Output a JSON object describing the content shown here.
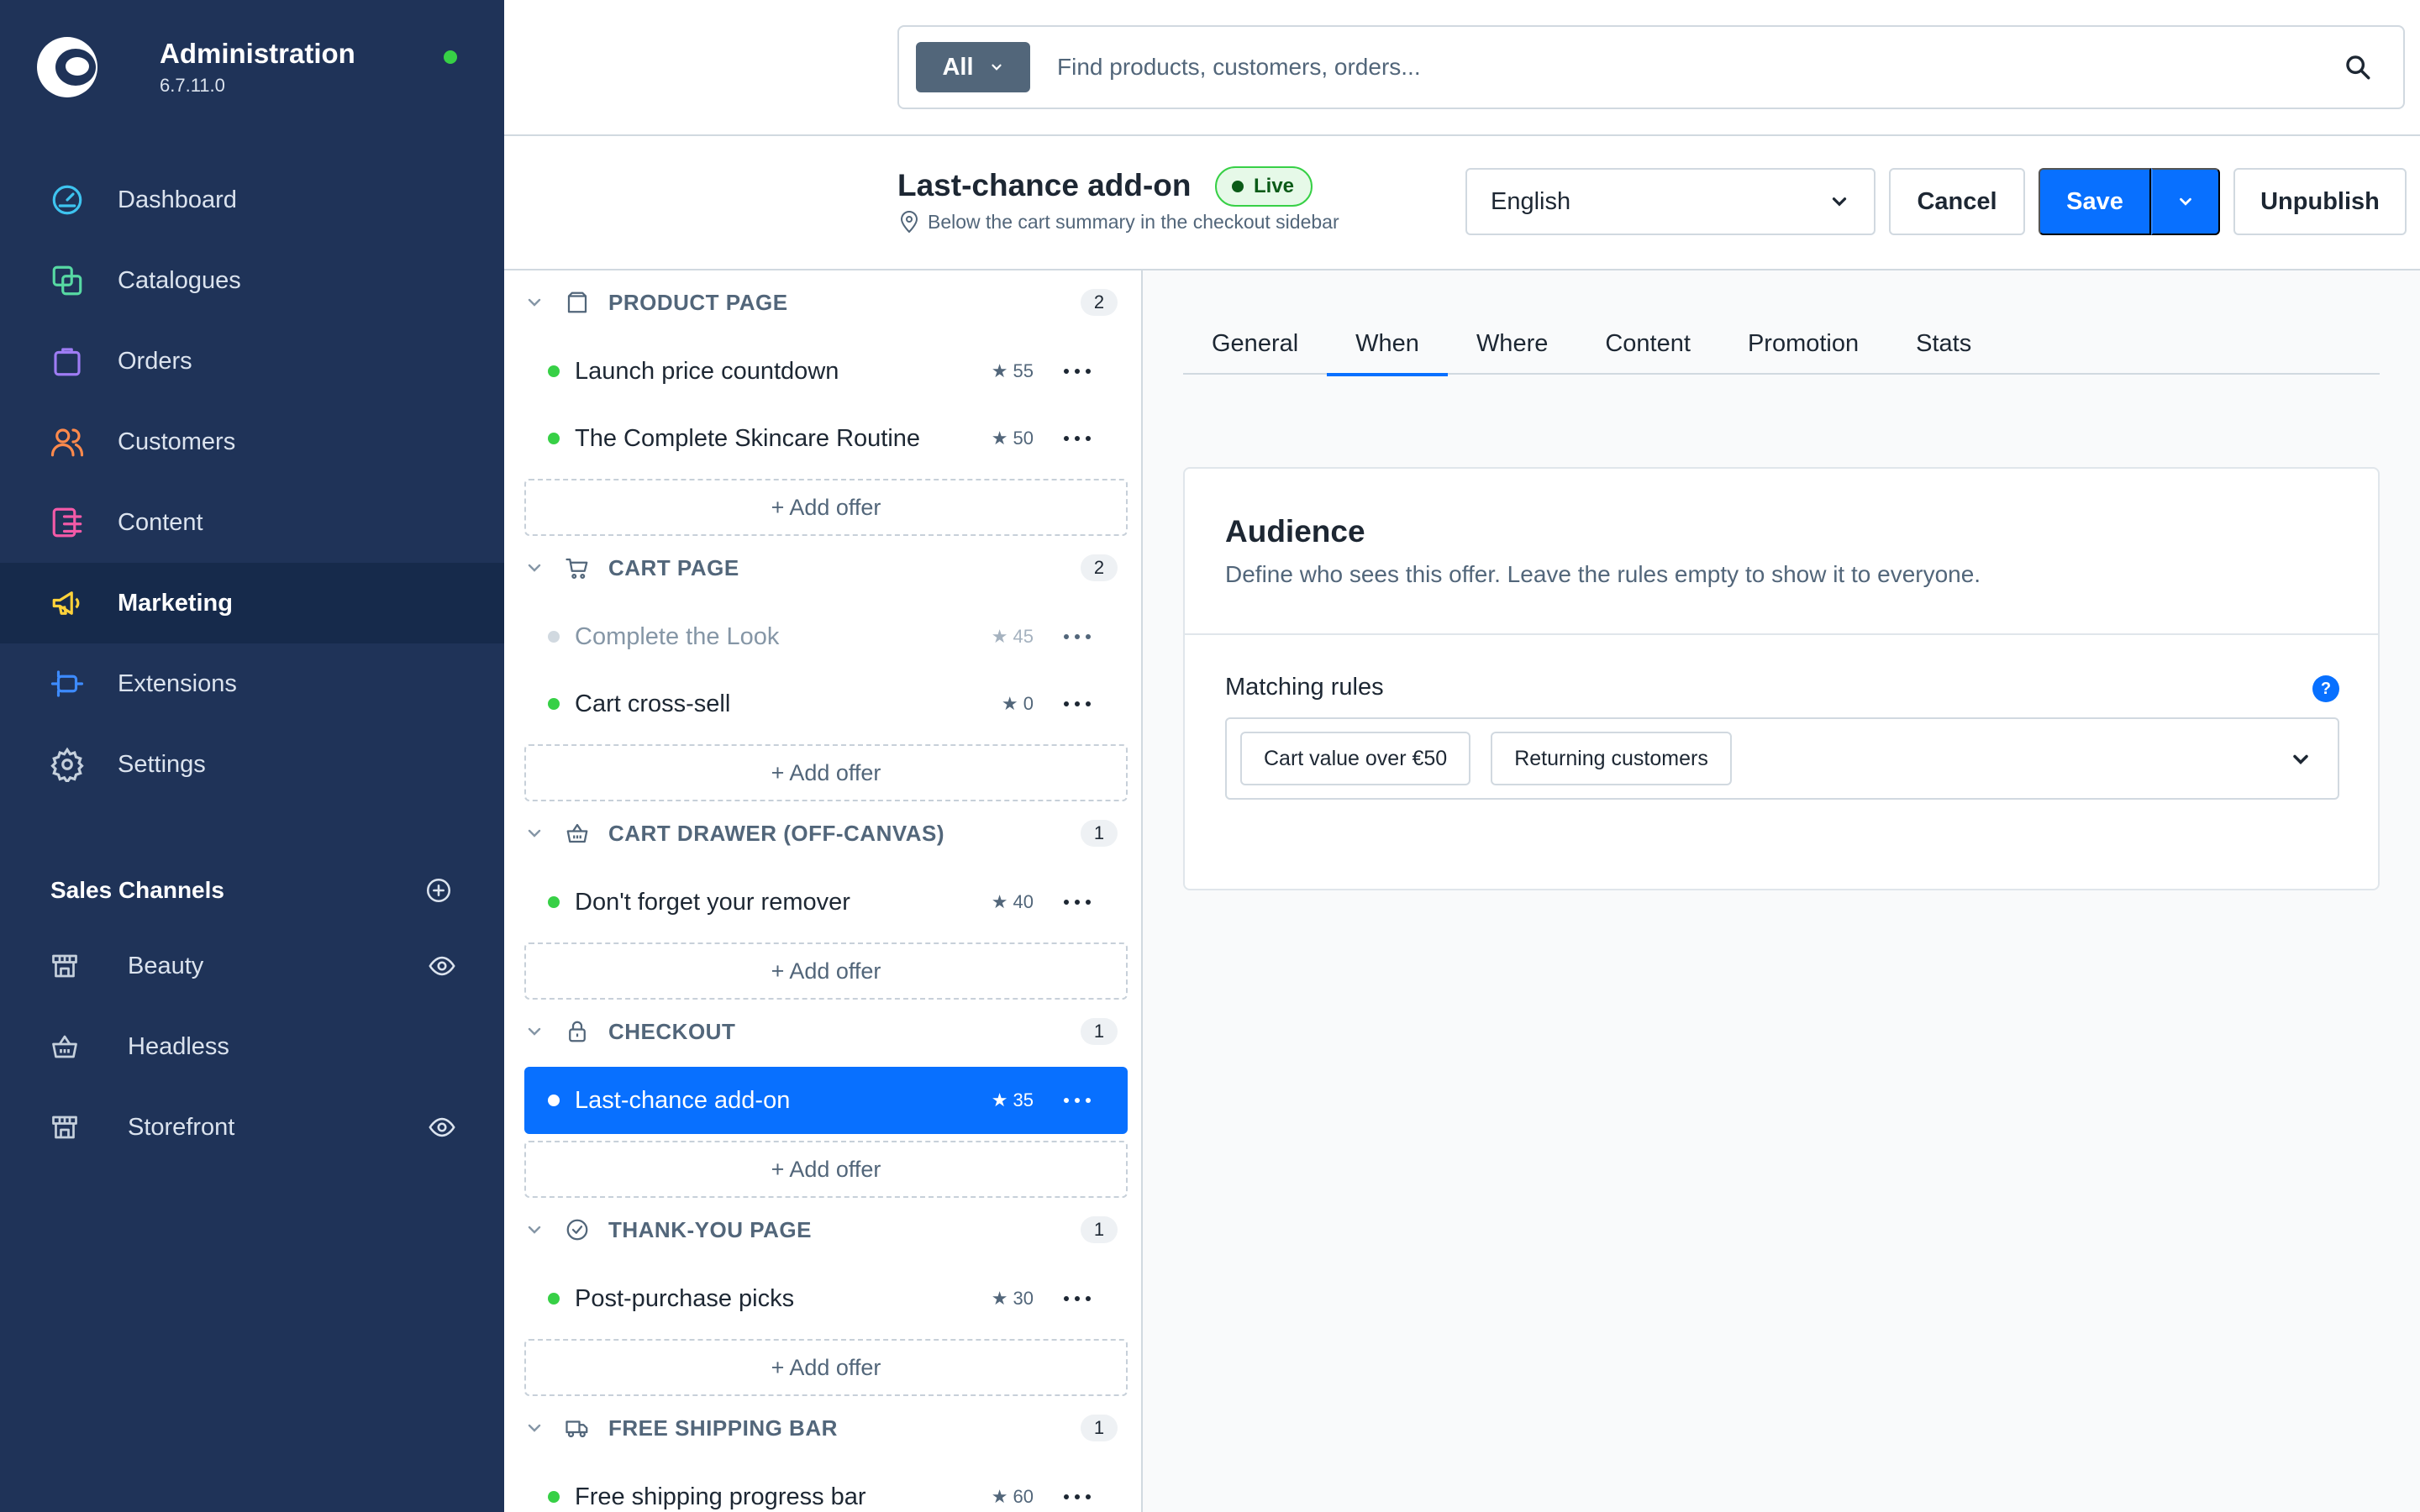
{
  "app": {
    "title": "Administration",
    "version": "6.7.11.0",
    "status_color": "#37d046"
  },
  "nav": {
    "items": [
      {
        "label": "Dashboard",
        "icon": "dashboard-icon",
        "color": "#3ec4f0"
      },
      {
        "label": "Catalogues",
        "icon": "catalogues-icon",
        "color": "#57d9a3"
      },
      {
        "label": "Orders",
        "icon": "orders-icon",
        "color": "#9e7cf4"
      },
      {
        "label": "Customers",
        "icon": "customers-icon",
        "color": "#ff8a4c"
      },
      {
        "label": "Content",
        "icon": "content-icon",
        "color": "#f25aa7"
      },
      {
        "label": "Marketing",
        "icon": "marketing-icon",
        "color": "#ffd23a",
        "active": true
      },
      {
        "label": "Extensions",
        "icon": "extensions-icon",
        "color": "#3d8bff"
      },
      {
        "label": "Settings",
        "icon": "settings-icon",
        "color": "#c5d0dc"
      }
    ]
  },
  "sales_channels": {
    "title": "Sales Channels",
    "items": [
      {
        "label": "Beauty",
        "icon": "storefront-icon",
        "visible_toggle": true
      },
      {
        "label": "Headless",
        "icon": "basket-icon",
        "visible_toggle": false
      },
      {
        "label": "Storefront",
        "icon": "storefront-icon",
        "visible_toggle": true
      }
    ]
  },
  "search": {
    "filter_label": "All",
    "placeholder": "Find products, customers, orders..."
  },
  "offer": {
    "title": "Last-chance add-on",
    "status": "Live",
    "location": "Below the cart summary in the checkout sidebar",
    "language": "English",
    "actions": {
      "cancel": "Cancel",
      "save": "Save",
      "unpublish": "Unpublish"
    }
  },
  "groups": [
    {
      "title": "PRODUCT PAGE",
      "count": "2",
      "icon": "product-page-icon",
      "offers": [
        {
          "name": "Launch price countdown",
          "priority": "★ 55",
          "active": true
        },
        {
          "name": "The Complete Skincare Routine",
          "priority": "★ 50",
          "active": true
        }
      ]
    },
    {
      "title": "CART PAGE",
      "count": "2",
      "icon": "cart-icon",
      "offers": [
        {
          "name": "Complete the Look",
          "priority": "★ 45",
          "active": false
        },
        {
          "name": "Cart cross-sell",
          "priority": "★ 0",
          "active": true
        }
      ]
    },
    {
      "title": "CART DRAWER (OFF-CANVAS)",
      "count": "1",
      "icon": "basket-icon",
      "offers": [
        {
          "name": "Don't forget your remover",
          "priority": "★ 40",
          "active": true
        }
      ]
    },
    {
      "title": "CHECKOUT",
      "count": "1",
      "icon": "lock-icon",
      "offers": [
        {
          "name": "Last-chance add-on",
          "priority": "★ 35",
          "active": true,
          "selected": true
        }
      ]
    },
    {
      "title": "THANK-YOU PAGE",
      "count": "1",
      "icon": "check-circle-icon",
      "offers": [
        {
          "name": "Post-purchase picks",
          "priority": "★ 30",
          "active": true
        }
      ]
    },
    {
      "title": "FREE SHIPPING BAR",
      "count": "1",
      "icon": "truck-icon",
      "offers": [
        {
          "name": "Free shipping progress bar",
          "priority": "★ 60",
          "active": true
        }
      ]
    }
  ],
  "add_offer_label": "+ Add offer",
  "tabs": [
    {
      "label": "General"
    },
    {
      "label": "When",
      "active": true
    },
    {
      "label": "Where"
    },
    {
      "label": "Content"
    },
    {
      "label": "Promotion"
    },
    {
      "label": "Stats"
    }
  ],
  "audience": {
    "title": "Audience",
    "description": "Define who sees this offer. Leave the rules empty to show it to everyone.",
    "rules_label": "Matching rules",
    "help": "?",
    "rules": [
      "Cart value over €50",
      "Returning customers"
    ]
  },
  "colors": {
    "accent": "#0870ff",
    "sidebar": "#1f3358",
    "live": "#37d046"
  }
}
